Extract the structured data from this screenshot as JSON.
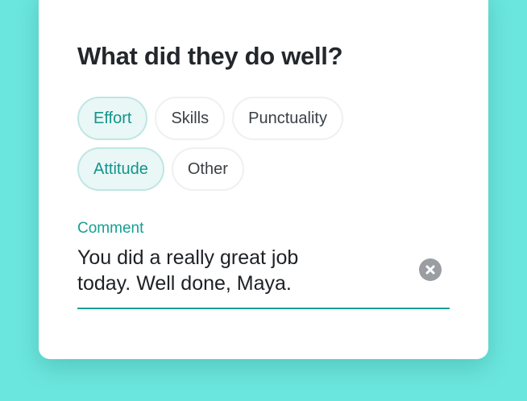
{
  "feedback": {
    "question": "What did they do well?",
    "chips": [
      [
        {
          "label": "Effort",
          "selected": true
        },
        {
          "label": "Skills",
          "selected": false
        },
        {
          "label": "Punctuality",
          "selected": false
        }
      ],
      [
        {
          "label": "Attitude",
          "selected": true
        },
        {
          "label": "Other",
          "selected": false
        }
      ]
    ],
    "comment": {
      "label": "Comment",
      "value_line1": "You did a really great job",
      "value_line2": "today. Well done, Maya.",
      "clear_icon": "close-circle-icon"
    }
  },
  "colors": {
    "background": "#6be6de",
    "accent": "#16a094",
    "selected_chip_bg": "#e9f7f6",
    "clear_icon": "#9a9da1"
  }
}
